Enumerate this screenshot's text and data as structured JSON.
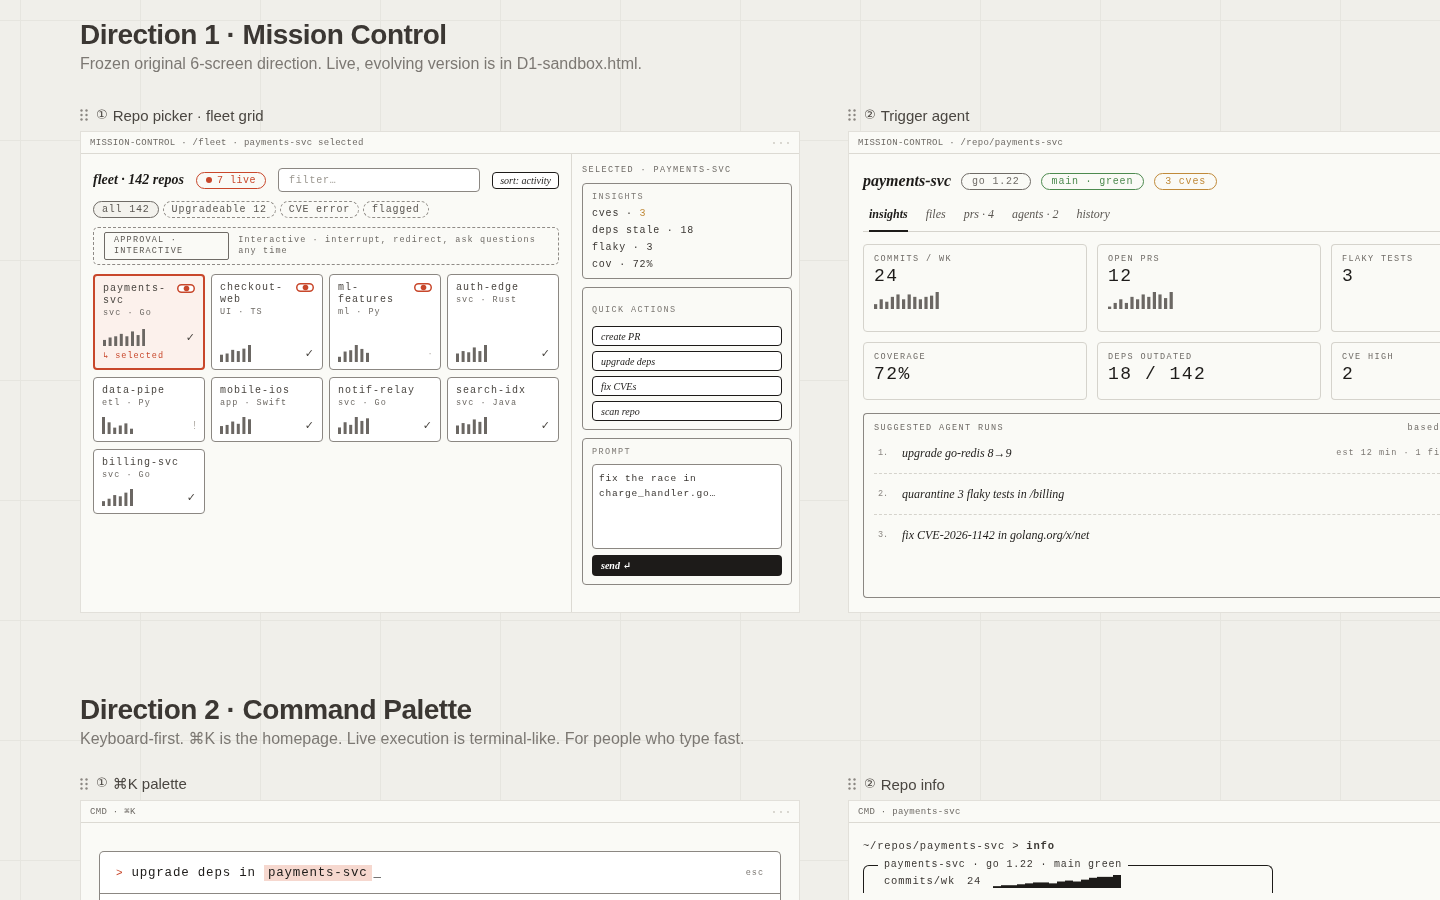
{
  "sections": [
    {
      "title": "Direction 1 · Mission Control",
      "subtitle": "Frozen original 6-screen direction. Live, evolving version is in D1-sandbox.html.",
      "frames": [
        {
          "kind": "fleet",
          "number": "①",
          "label": "Repo picker · fleet grid",
          "breadcrumb": "MISSION-CONTROL · /fleet · payments-svc selected",
          "fleet_title": "fleet · 142 repos",
          "live_badge": "7 live",
          "filter_placeholder": "filter…",
          "sort_button": "sort: activity",
          "filters": [
            {
              "label": "all 142",
              "selected": true
            },
            {
              "label": "Upgradeable 12",
              "selected": false
            },
            {
              "label": "CVE error",
              "selected": false
            },
            {
              "label": "flagged",
              "selected": false
            }
          ],
          "approval": {
            "badge": "APPROVAL · INTERACTIVE",
            "text": "Interactive · interrupt, redirect, ask questions any time"
          },
          "repos": [
            {
              "name": "payments-svc",
              "meta": "svc · Go",
              "live": true,
              "selected": true,
              "status": "✓",
              "note": "↳ selected"
            },
            {
              "name": "checkout-web",
              "meta": "UI · TS",
              "live": true,
              "selected": false,
              "status": "✓"
            },
            {
              "name": "ml-features",
              "meta": "ml · Py",
              "live": true,
              "selected": false,
              "status": "·"
            },
            {
              "name": "auth-edge",
              "meta": "svc · Rust",
              "live": false,
              "selected": false,
              "status": "✓"
            },
            {
              "name": "data-pipe",
              "meta": "etl · Py",
              "live": false,
              "selected": false,
              "status": "!"
            },
            {
              "name": "mobile-ios",
              "meta": "app · Swift",
              "live": false,
              "selected": false,
              "status": "✓"
            },
            {
              "name": "notif-relay",
              "meta": "svc · Go",
              "live": false,
              "selected": false,
              "status": "✓"
            },
            {
              "name": "search-idx",
              "meta": "svc · Java",
              "live": false,
              "selected": false,
              "status": "✓"
            },
            {
              "name": "billing-svc",
              "meta": "svc · Go",
              "live": false,
              "selected": false,
              "status": "✓"
            }
          ],
          "side": {
            "heading": "SELECTED · PAYMENTS-SVC",
            "insights_title": "INSIGHTS",
            "insights": [
              {
                "label": "cves · ",
                "value": "3",
                "warning": true
              },
              {
                "label": "deps stale · ",
                "value": "18",
                "warning": false
              },
              {
                "label": "flaky · ",
                "value": "3",
                "warning": false
              },
              {
                "label": "cov · ",
                "value": "72%",
                "warning": false
              }
            ],
            "actions_title": "QUICK ACTIONS",
            "actions": [
              "create PR",
              "upgrade deps",
              "fix CVEs",
              "scan repo"
            ],
            "prompt_title": "PROMPT",
            "prompt_value": "fix the race in charge_handler.go…",
            "send_button": "send ↵"
          }
        },
        {
          "kind": "repo",
          "number": "②",
          "label": "Trigger agent",
          "breadcrumb": "MISSION-CONTROL · /repo/payments-svc",
          "repo_title": "payments-svc",
          "tags": [
            {
              "label": "go 1.22",
              "color": "#6f6b66"
            },
            {
              "label": "main · green",
              "color": "#4d8a4f"
            },
            {
              "label": "3 cves",
              "color": "#c08a3a"
            }
          ],
          "tabs": [
            {
              "label": "insights",
              "selected": true
            },
            {
              "label": "files",
              "selected": false
            },
            {
              "label": "prs · 4",
              "selected": false
            },
            {
              "label": "agents · 2",
              "selected": false
            },
            {
              "label": "history",
              "selected": false
            }
          ],
          "metrics": [
            {
              "label": "COMMITS / WK",
              "value": "24",
              "kind": "sparkline"
            },
            {
              "label": "OPEN PRS",
              "value": "12",
              "kind": "sparkline"
            },
            {
              "label": "FLAKY TESTS",
              "value": "3",
              "kind": "plain"
            },
            {
              "label": "COVERAGE",
              "value": "72%",
              "kind": "plain"
            },
            {
              "label": "DEPS OUTDATED",
              "value": "18 / 142",
              "kind": "plain"
            },
            {
              "label": "CVE HIGH",
              "value": "2",
              "kind": "plain"
            }
          ],
          "runs_title": "SUGGESTED AGENT RUNS",
          "runs_note": "based",
          "runs": [
            {
              "number": "1.",
              "text": "upgrade go-redis 8→9",
              "meta": "est 12 min · 1 fi"
            },
            {
              "number": "2.",
              "text": "quarantine 3 flaky tests in /billing"
            },
            {
              "number": "3.",
              "text": "fix CVE-2026-1142 in golang.org/x/net"
            }
          ]
        }
      ]
    },
    {
      "title": "Direction 2 · Command Palette",
      "subtitle": "Keyboard-first. ⌘K is the homepage. Live execution is terminal-like. For people who type fast.",
      "frames": [
        {
          "kind": "palette",
          "number": "①",
          "label": "⌘K palette",
          "breadcrumb": "CMD · ⌘K",
          "prompt": ">",
          "query": "upgrade deps in",
          "highlight": "payments-svc",
          "cursor": "_",
          "hint": "esc"
        },
        {
          "kind": "terminal",
          "number": "②",
          "label": "Repo info",
          "breadcrumb": "CMD · payments-svc",
          "path": "~/repos/payments-svc",
          "separator": ">",
          "command": "info",
          "box_title": "payments-svc · go 1.22 · main green",
          "row_label": "commits/wk",
          "row_value": "24"
        }
      ]
    }
  ]
}
